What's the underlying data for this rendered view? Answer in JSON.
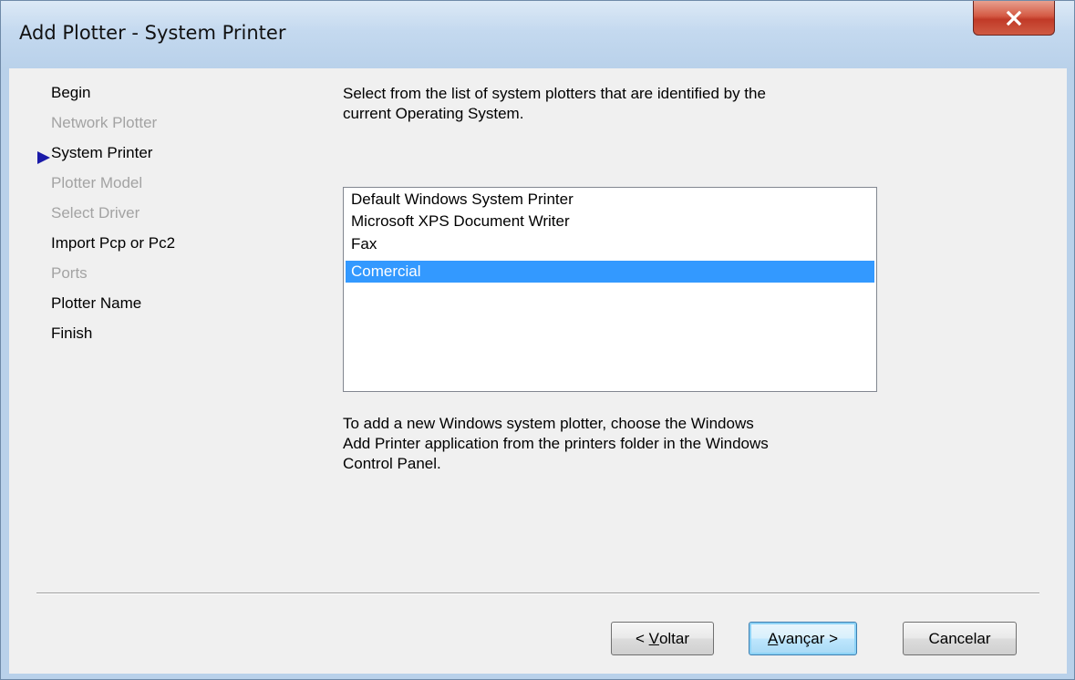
{
  "window": {
    "title": "Add Plotter - System Printer"
  },
  "steps": [
    {
      "label": "Begin",
      "enabled": true
    },
    {
      "label": "Network Plotter",
      "enabled": false
    },
    {
      "label": "System Printer",
      "enabled": true,
      "current": true
    },
    {
      "label": "Plotter Model",
      "enabled": false
    },
    {
      "label": "Select Driver",
      "enabled": false
    },
    {
      "label": "Import Pcp or Pc2",
      "enabled": true
    },
    {
      "label": "Ports",
      "enabled": false
    },
    {
      "label": "Plotter Name",
      "enabled": true
    },
    {
      "label": "Finish",
      "enabled": true
    }
  ],
  "instructions": {
    "line1": "Select from the list of system plotters that are identified by the",
    "line2": "current Operating System."
  },
  "plotters": {
    "items": [
      "Default Windows System Printer",
      "Microsoft XPS Document Writer",
      "Fax",
      "Comercial"
    ],
    "selected": "Comercial"
  },
  "help": {
    "line1": "To add a new Windows system plotter, choose the Windows",
    "line2": "Add Printer application from the printers folder in the Windows",
    "line3": "Control Panel."
  },
  "buttons": {
    "back_prefix": "< ",
    "back_mnemonic": "V",
    "back_rest": "oltar",
    "next_mnemonic": "A",
    "next_rest": "vançar >",
    "cancel": "Cancelar"
  },
  "colors": {
    "selection": "#3399ff",
    "disabled_text": "#a3a3a3",
    "current_step_arrow": "#1a1aa8",
    "close_button": "#c13a27"
  },
  "icons": {
    "close": "close-icon",
    "current_step": "current-step-arrow-icon"
  }
}
